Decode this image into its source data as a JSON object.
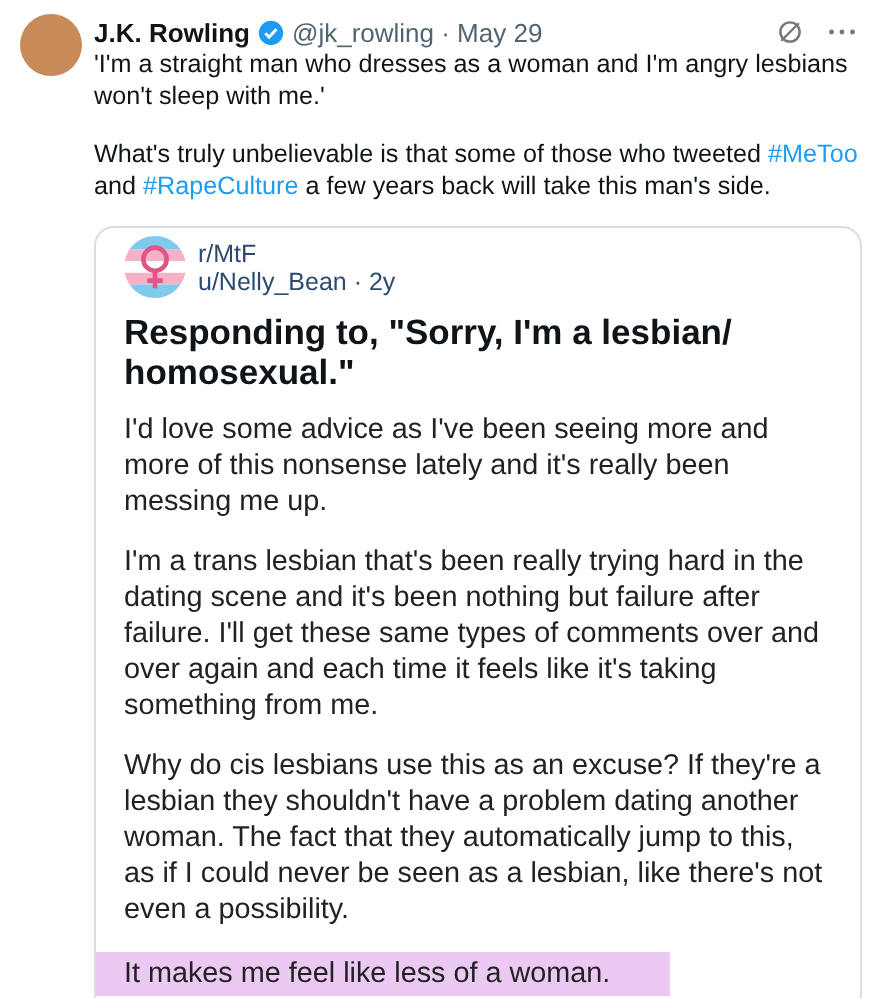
{
  "tweet": {
    "author": {
      "name": "J.K. Rowling",
      "verified": true,
      "meta": "@jk_rowling · May 29"
    },
    "paragraphs": [
      [
        {
          "kind": "text",
          "text": "'I'm a straight man who dresses as a woman and I'm angry lesbians won't sleep with me.'"
        }
      ],
      [
        {
          "kind": "text",
          "text": "What's truly unbelievable is that some of those who tweeted "
        },
        {
          "kind": "hashtag",
          "text": "#MeToo"
        },
        {
          "kind": "text",
          "text": " and "
        },
        {
          "kind": "hashtag",
          "text": "#RapeCulture"
        },
        {
          "kind": "text",
          "text": " a few years back will take this man's side."
        }
      ]
    ]
  },
  "embed": {
    "subreddit": "r/MtF",
    "user_meta": "u/Nelly_Bean · 2y",
    "title": "Responding to, \"Sorry, I'm a lesbian/ homosexual.\"",
    "paragraphs": [
      {
        "text": "I'd love some advice as I've been seeing more and more of this nonsense lately and it's really been messing me up.",
        "highlighted": false
      },
      {
        "text": "I'm a trans lesbian that's been really trying hard in the dating scene and it's been nothing but failure after failure. I'll get these same types of comments over and over again and each time it feels like it's taking something from me.",
        "highlighted": false
      },
      {
        "text": "Why do cis lesbians use this as an excuse? If they're a lesbian they shouldn't have a problem dating another woman. The fact that they automatically jump to this, as if I could never be seen as a lesbian, like there's not even a possibility.",
        "highlighted": false
      },
      {
        "text": "It makes me feel like less of a woman.",
        "highlighted": true
      }
    ]
  }
}
